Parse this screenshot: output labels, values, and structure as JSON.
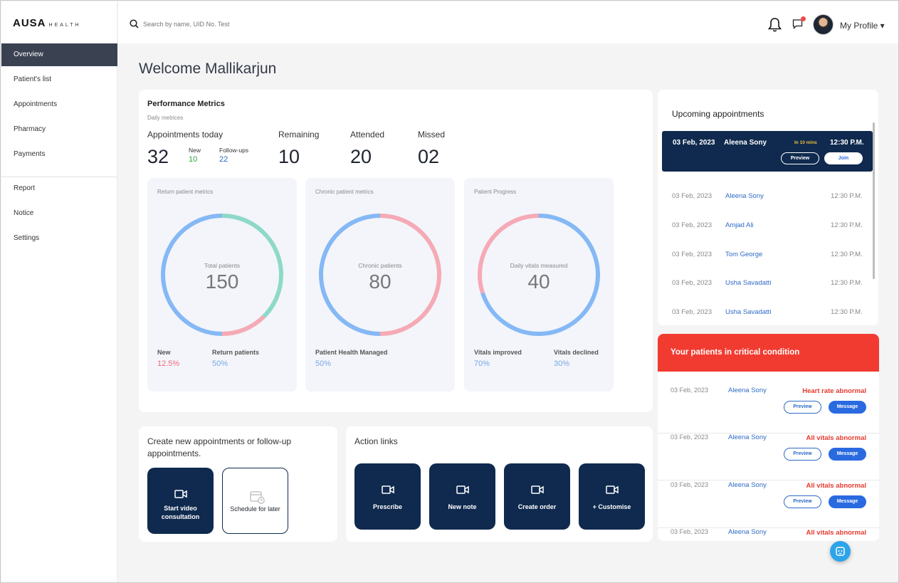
{
  "brand": {
    "name": "AUSA",
    "sub": "HEALTH"
  },
  "nav": {
    "items": [
      "Overview",
      "Patient's list",
      "Appointments",
      "Pharmacy",
      "Payments"
    ],
    "items2": [
      "Report",
      "Notice",
      "Settings"
    ]
  },
  "search": {
    "placeholder": "Search by name, UID No. Test"
  },
  "profile": {
    "label": "My Profile ▾"
  },
  "welcome": "Welcome Mallikarjun",
  "performance": {
    "title": "Performance Metrics",
    "subtitle": "Daily metrices",
    "appointments_label": "Appointments today",
    "appointments_value": "32",
    "new_label": "New",
    "new_value": "10",
    "followups_label": "Follow-ups",
    "followups_value": "22",
    "remaining_label": "Remaining",
    "remaining_value": "10",
    "attended_label": "Attended",
    "attended_value": "20",
    "missed_label": "Missed",
    "missed_value": "02"
  },
  "rings": [
    {
      "title": "Return patient metrics",
      "center_label": "Total patients",
      "center_value": "150",
      "leg1": "New",
      "leg1v": "12.5%",
      "leg2": "Return patients",
      "leg2v": "50%",
      "segments": [
        {
          "color": "#8ed9c9",
          "frac": 0.375
        },
        {
          "color": "#f5aab5",
          "frac": 0.125
        },
        {
          "color": "#85b8f5",
          "frac": 0.5
        }
      ]
    },
    {
      "title": "Chronic patient metrics",
      "center_label": "Chronic patients",
      "center_value": "80",
      "leg1": "Patient Health Managed",
      "leg1v": "50%",
      "segments": [
        {
          "color": "#f5aab5",
          "frac": 0.5
        },
        {
          "color": "#85b8f5",
          "frac": 0.5
        }
      ]
    },
    {
      "title": "Patient Progress",
      "center_label": "Daily vitals measured",
      "center_value": "40",
      "leg1": "Vitals improved",
      "leg1v": "70%",
      "leg2": "Vitals declined",
      "leg2v": "30%",
      "segments": [
        {
          "color": "#85b8f5",
          "frac": 0.7
        },
        {
          "color": "#f5aab5",
          "frac": 0.3
        }
      ]
    }
  ],
  "create": {
    "title": "Create new appointments or follow-up appointments.",
    "video": "Start video consultation",
    "schedule": "Schedule for later"
  },
  "actions": {
    "title": "Action links",
    "items": [
      "Prescribe",
      "New note",
      "Create order",
      "+ Customise"
    ]
  },
  "upcoming": {
    "title": "Upcoming appointments",
    "active": {
      "date": "03 Feb, 2023",
      "name": "Aleena Sony",
      "in": "In 10 mins",
      "time": "12:30 P.M.",
      "preview": "Preview",
      "join": "Join"
    },
    "rows": [
      {
        "date": "03 Feb, 2023",
        "name": "Aleena Sony",
        "time": "12:30 P.M."
      },
      {
        "date": "03 Feb, 2023",
        "name": "Amjad Ali",
        "time": "12:30 P.M."
      },
      {
        "date": "03 Feb, 2023",
        "name": "Tom George",
        "time": "12:30 P.M."
      },
      {
        "date": "03 Feb, 2023",
        "name": "Usha Savadatti",
        "time": "12:30 P.M."
      },
      {
        "date": "03 Feb, 2023",
        "name": "Usha Savadatti",
        "time": "12:30 P.M."
      }
    ]
  },
  "critical": {
    "title": "Your patients in critical condition",
    "preview": "Preview",
    "message": "Message",
    "rows": [
      {
        "date": "03 Feb, 2023",
        "name": "Aleena Sony",
        "status": "Heart rate abnormal"
      },
      {
        "date": "03 Feb, 2023",
        "name": "Aleena Sony",
        "status": "All vitals abnormal"
      },
      {
        "date": "03 Feb, 2023",
        "name": "Aleena Sony",
        "status": "All vitals abnormal"
      },
      {
        "date": "03 Feb, 2023",
        "name": "Aleena Sony",
        "status": "All vitals abnormal"
      }
    ]
  }
}
